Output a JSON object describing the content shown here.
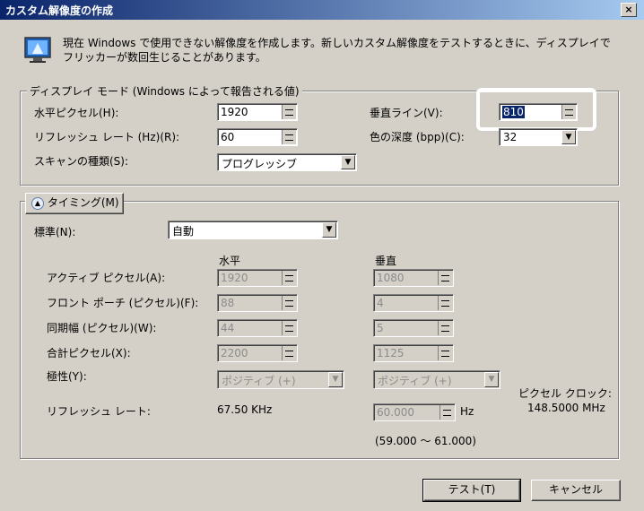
{
  "window": {
    "title": "カスタム解像度の作成",
    "close_label": "×"
  },
  "info": {
    "text": "現在 Windows で使用できない解像度を作成します。新しいカスタム解像度をテストするときに、ディスプレイでフリッカーが数回生じることがあります。",
    "icon": "monitor-info-icon"
  },
  "display_mode": {
    "legend": "ディスプレイ モード (Windows によって報告される値)",
    "horizontal_pixels": {
      "label": "水平ピクセル(H):",
      "value": "1920"
    },
    "vertical_lines": {
      "label": "垂直ライン(V):",
      "value": "810"
    },
    "refresh_rate": {
      "label": "リフレッシュ レート (Hz)(R):",
      "value": "60"
    },
    "color_depth": {
      "label": "色の深度 (bpp)(C):",
      "value": "32"
    },
    "scan_type": {
      "label": "スキャンの種類(S):",
      "value": "プログレッシブ"
    }
  },
  "timing": {
    "toggle_label": "タイミング(M)",
    "standard": {
      "label": "標準(N):",
      "value": "自動"
    },
    "col_horizontal": "水平",
    "col_vertical": "垂直",
    "active_pixels": {
      "label": "アクティブ ピクセル(A):",
      "h": "1920",
      "v": "1080"
    },
    "front_porch": {
      "label": "フロント ポーチ (ピクセル)(F):",
      "h": "88",
      "v": "4"
    },
    "sync_width": {
      "label": "同期幅 (ピクセル)(W):",
      "h": "44",
      "v": "5"
    },
    "total_pixels": {
      "label": "合計ピクセル(X):",
      "h": "2200",
      "v": "1125"
    },
    "polarity": {
      "label": "極性(Y):",
      "h": "ポジティブ (+)",
      "v": "ポジティブ (+)"
    },
    "refresh_rate": {
      "label": "リフレッシュ レート:",
      "h": "67.50 KHz",
      "v": "60.000",
      "unit": "Hz",
      "range": "(59.000 〜 61.000)"
    },
    "pixel_clock": {
      "label": "ピクセル クロック:",
      "value": "148.5000 MHz"
    }
  },
  "buttons": {
    "test": "テスト(T)",
    "cancel": "キャンセル"
  }
}
